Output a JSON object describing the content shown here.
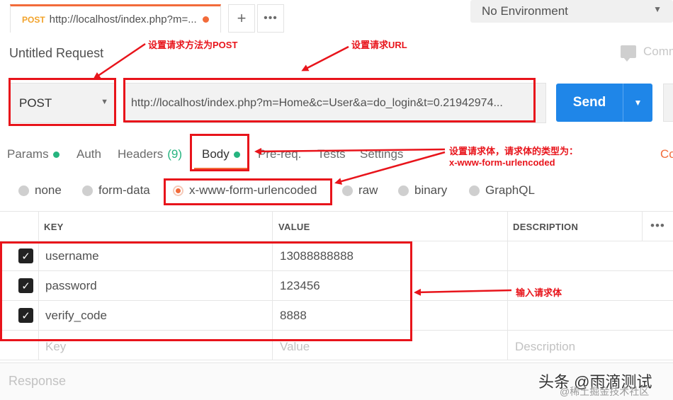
{
  "tab": {
    "method": "POST",
    "url": "http://localhost/index.php?m=..."
  },
  "environment": {
    "selected": "No Environment"
  },
  "request": {
    "title": "Untitled Request",
    "comments_label": "Comm",
    "method": "POST",
    "url": "http://localhost/index.php?m=Home&c=User&a=do_login&t=0.21942974...",
    "send_label": "Send"
  },
  "subtabs": [
    {
      "label": "Params"
    },
    {
      "label": "Auth"
    },
    {
      "label": "Headers",
      "count": "(9)"
    },
    {
      "label": "Body"
    },
    {
      "label": "Pre-req."
    },
    {
      "label": "Tests"
    },
    {
      "label": "Settings"
    }
  ],
  "cookies_link": "Co",
  "body_types": {
    "selected": "x-www-form-urlencoded",
    "options": [
      "none",
      "form-data",
      "x-www-form-urlencoded",
      "raw",
      "binary",
      "GraphQL"
    ]
  },
  "table": {
    "headers": {
      "key": "KEY",
      "value": "VALUE",
      "description": "DESCRIPTION"
    },
    "rows": [
      {
        "checked": true,
        "key": "username",
        "value": "13088888888"
      },
      {
        "checked": true,
        "key": "password",
        "value": "123456"
      },
      {
        "checked": true,
        "key": "verify_code",
        "value": "8888"
      }
    ],
    "placeholders": {
      "key": "Key",
      "value": "Value",
      "description": "Description"
    }
  },
  "response_label": "Response",
  "annotations": {
    "method": "设置请求方法为POST",
    "url": "设置请求URL",
    "body_line1": "设置请求体，请求体的类型为：",
    "body_line2": "x-www-form-urlencoded",
    "input": "输入请求体"
  },
  "watermark": {
    "main": "头条 @雨滴测试",
    "sub": "@稀土掘金技术社区"
  },
  "colors": {
    "accent": "#f26b3a",
    "send": "#1f86e8",
    "annotation": "#e8141b",
    "green": "#26b47f"
  }
}
